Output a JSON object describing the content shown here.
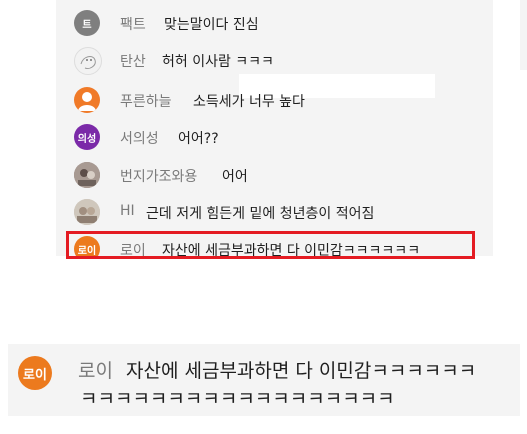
{
  "chat": {
    "messages": [
      {
        "author": "팩트",
        "avatar_label": "트",
        "avatar_color": "#7f7f7f",
        "text": "맞는말이다 진심"
      },
      {
        "author": "탄산",
        "avatar_label": "",
        "avatar_color": "#f2f2f2",
        "text": "허허 이사람 ㅋㅋㅋ"
      },
      {
        "author": "푸른하늘",
        "avatar_label": "",
        "avatar_color": "#f07a28",
        "text": "소득세가 너무 높다"
      },
      {
        "author": "서의성",
        "avatar_label": "의성",
        "avatar_color": "#7b2aa8",
        "text": "어어??"
      },
      {
        "author": "번지가조와용",
        "avatar_label": "",
        "avatar_color": "#8a7a78",
        "text": "어어"
      },
      {
        "author": "HI",
        "avatar_label": "",
        "avatar_color": "#c7bfb3",
        "text": "근데 저게 힘든게 밑에 청년층이 적어짐"
      },
      {
        "author": "로이",
        "avatar_label": "로이",
        "avatar_color": "#ec7a1e",
        "text": "자산에 세금부과하면 다 이민감ㅋㅋㅋㅋㅋㅋ"
      }
    ]
  },
  "zoom": {
    "author": "로이",
    "avatar_label": "로이",
    "avatar_color": "#ec7a1e",
    "text_line1": "자산에 세금부과하면 다 이민감ㅋㅋㅋㅋㅋㅋ",
    "text_line2": "ㅋㅋㅋㅋㅋㅋㅋㅋㅋㅋㅋㅋㅋㅋㅋㅋㅋㅋ"
  },
  "highlight_color": "#e41b22"
}
